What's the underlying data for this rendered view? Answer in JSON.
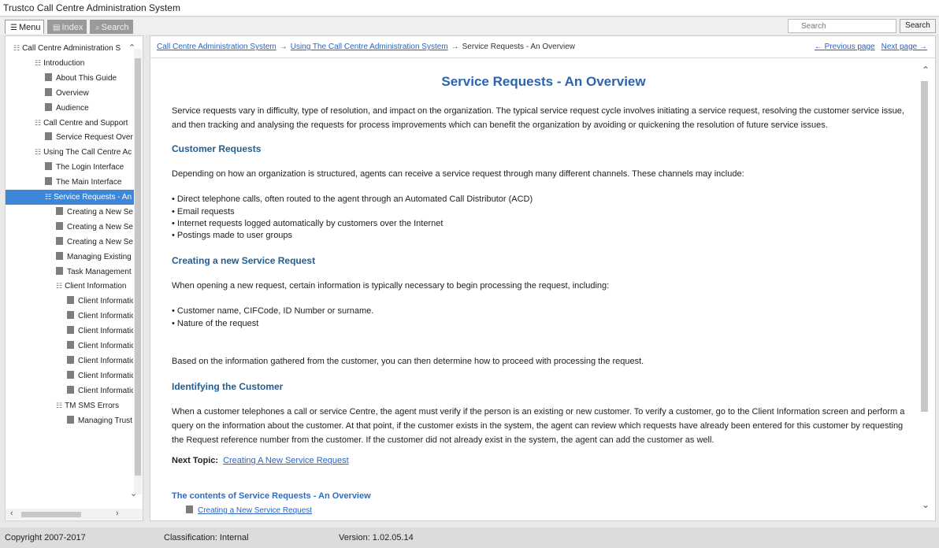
{
  "window": {
    "title": "Trustco Call Centre Administration System"
  },
  "toolbar": {
    "tabs": [
      {
        "label": "Menu",
        "icon": "list-icon"
      },
      {
        "label": "Index",
        "icon": "index-icon"
      },
      {
        "label": "Search",
        "icon": "search-icon"
      }
    ],
    "search_placeholder": "Search",
    "search_button": "Search"
  },
  "sidebar": {
    "items": [
      {
        "label": "Call Centre Administration S",
        "type": "book",
        "level": 0
      },
      {
        "label": "Introduction",
        "type": "book",
        "level": 1
      },
      {
        "label": "About This Guide",
        "type": "page",
        "level": 2
      },
      {
        "label": "Overview",
        "type": "page",
        "level": 2
      },
      {
        "label": "Audience",
        "type": "page",
        "level": 2
      },
      {
        "label": "Call Centre and Support",
        "type": "book",
        "level": 1
      },
      {
        "label": "Service Request Over",
        "type": "page",
        "level": 2
      },
      {
        "label": "Using The Call Centre Ac",
        "type": "book",
        "level": 1
      },
      {
        "label": "The Login Interface",
        "type": "page",
        "level": 2
      },
      {
        "label": "The Main Interface",
        "type": "page",
        "level": 2
      },
      {
        "label": "Service Requests - An",
        "type": "book",
        "level": 2,
        "selected": true
      },
      {
        "label": "Creating a New Se",
        "type": "page",
        "level": 3
      },
      {
        "label": "Creating a New Se",
        "type": "page",
        "level": 3
      },
      {
        "label": "Creating a New Se",
        "type": "page",
        "level": 3
      },
      {
        "label": "Managing Existing",
        "type": "page",
        "level": 3
      },
      {
        "label": "Task Management",
        "type": "page",
        "level": 3
      },
      {
        "label": "Client Information",
        "type": "book",
        "level": 3
      },
      {
        "label": "Client Informatic",
        "type": "page",
        "level": 4
      },
      {
        "label": "Client Informatic",
        "type": "page",
        "level": 4
      },
      {
        "label": "Client Informatic",
        "type": "page",
        "level": 4
      },
      {
        "label": "Client Informatic",
        "type": "page",
        "level": 4
      },
      {
        "label": "Client Informatic",
        "type": "page",
        "level": 4
      },
      {
        "label": "Client Informatic",
        "type": "page",
        "level": 4
      },
      {
        "label": "Client Informatic",
        "type": "page",
        "level": 4
      },
      {
        "label": "TM SMS Errors",
        "type": "book",
        "level": 3
      },
      {
        "label": "Managing Trust",
        "type": "page",
        "level": 4
      }
    ]
  },
  "breadcrumb": {
    "links": [
      "Call Centre Administration System",
      "Using The Call Centre Administration System"
    ],
    "separator": "→",
    "current": "Service Requests - An Overview"
  },
  "pager": {
    "prev": "← Previous page",
    "next": "Next page →"
  },
  "article": {
    "title": "Service Requests - An Overview",
    "intro": "Service requests vary in difficulty, type of resolution, and impact on the organization. The typical service request cycle involves initiating a service request, resolving the customer service issue, and then tracking and analysing the requests for process improvements which can benefit the organization by avoiding or quickening the resolution of future service issues.",
    "section1_title": "Customer Requests",
    "section1_text": "Depending on how an organization is structured, agents can receive a service request through many different channels. These channels may include:",
    "section1_bullets": [
      "• Direct telephone calls, often routed to the agent through an Automated Call Distributor (ACD)",
      "• Email requests",
      "• Internet requests logged automatically by customers over the Internet",
      "• Postings made to user groups"
    ],
    "section2_title": "Creating a new Service Request",
    "section2_text": "When opening a new request, certain information is typically necessary to begin processing the request, including:",
    "section2_bullets": [
      "• Customer name, CIFCode, ID Number or surname.",
      "• Nature of the request"
    ],
    "section2_after": "Based on the information gathered from the customer, you can then determine how to proceed with processing the request.",
    "section3_title": "Identifying the Customer",
    "section3_text": "When a customer telephones a call or service Centre, the agent must verify if the person is an existing or new customer. To verify a customer, go to the Client Information screen and perform a query on the information about the customer. At that point, if the customer exists in the system, the agent can review which requests have already been entered for this customer by requesting the Request reference number from the customer. If the customer did not already exist in the system, the agent can add the customer as well.",
    "next_topic_label": "Next Topic:",
    "next_topic_link": "Creating A New Service Request",
    "contents_title": "The contents of Service Requests - An Overview",
    "contents_link": "Creating a New Service Request"
  },
  "status": {
    "copyright": "Copyright 2007-2017",
    "classification": "Classification: Internal",
    "version": "Version: 1.02.05.14"
  },
  "colors": {
    "accent": "#3d87d8",
    "title": "#2d63ab",
    "link": "#2a62c5"
  }
}
